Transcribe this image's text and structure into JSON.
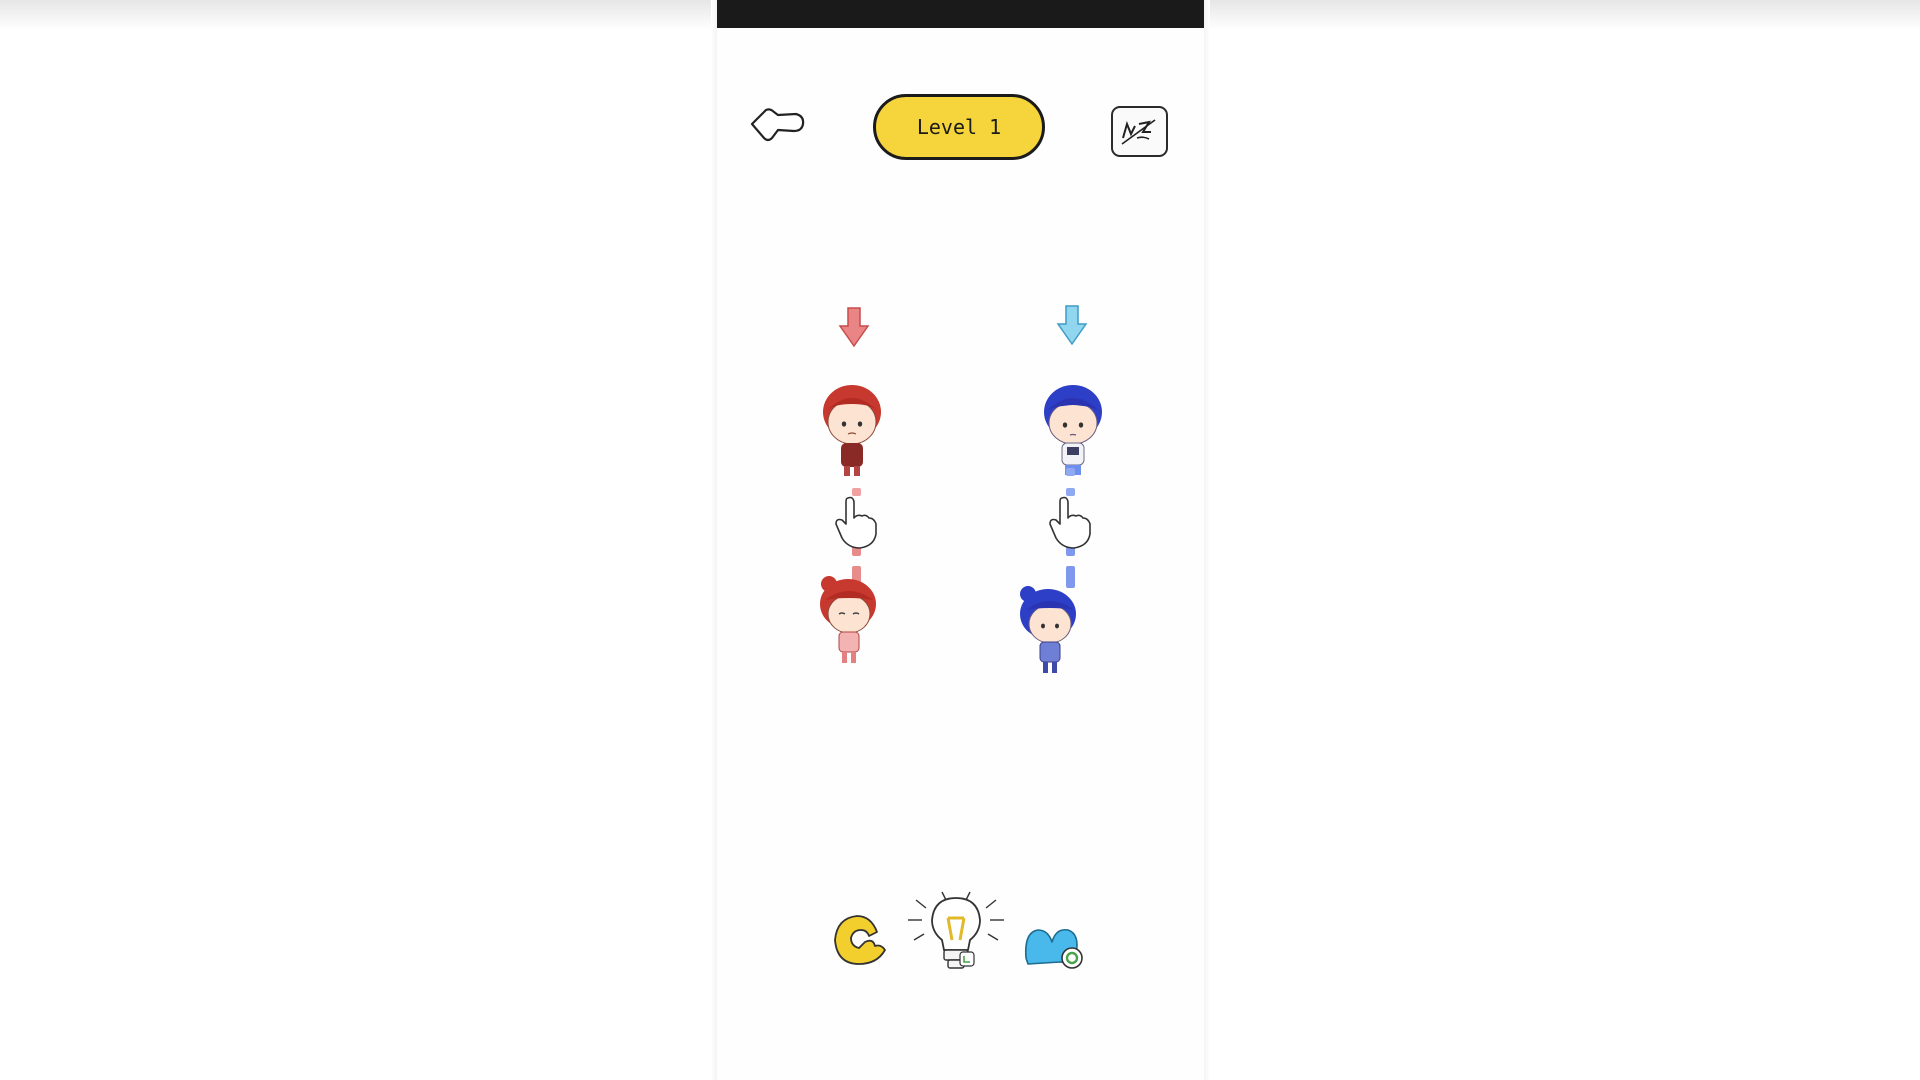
{
  "header": {
    "level_label": "Level 1"
  },
  "icons": {
    "back": "back-arrow-icon",
    "skip": "skip-level-icon",
    "restart": "restart-icon",
    "hint": "lightbulb-hint-icon",
    "no_ads": "no-ads-icon"
  },
  "colors": {
    "level_pill": "#f5d43c",
    "red_team": "#e06a6a",
    "blue_team": "#6f8ff0",
    "restart": "#f2cf2c",
    "no_ads": "#49b8ea"
  }
}
